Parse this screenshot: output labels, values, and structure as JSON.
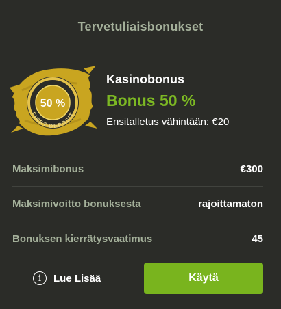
{
  "header": {
    "title": "Tervetuliaisbonukset"
  },
  "badge": {
    "percent": "50 %",
    "caption": "FIRST DEPOSIT",
    "icon": "first-deposit-badge-icon",
    "colors": {
      "gold": "#c9a520",
      "dark": "#2b2c28"
    }
  },
  "offer": {
    "name": "Kasinobonus",
    "bonus": "Bonus 50 %",
    "min_deposit": "Ensitalletus vähintään: €20"
  },
  "details": [
    {
      "label": "Maksimibonus",
      "value": "€300"
    },
    {
      "label": "Maksimivoitto bonuksesta",
      "value": "rajoittamaton"
    },
    {
      "label": "Bonuksen kierrätysvaatimus",
      "value": "45"
    }
  ],
  "actions": {
    "read_more_label": "Lue Lisää",
    "read_more_icon": "info-icon",
    "cta_label": "Käytä"
  },
  "colors": {
    "background": "#2b2c28",
    "accent": "#7cb823",
    "muted": "#a4b09a",
    "button": "#79b41e"
  }
}
